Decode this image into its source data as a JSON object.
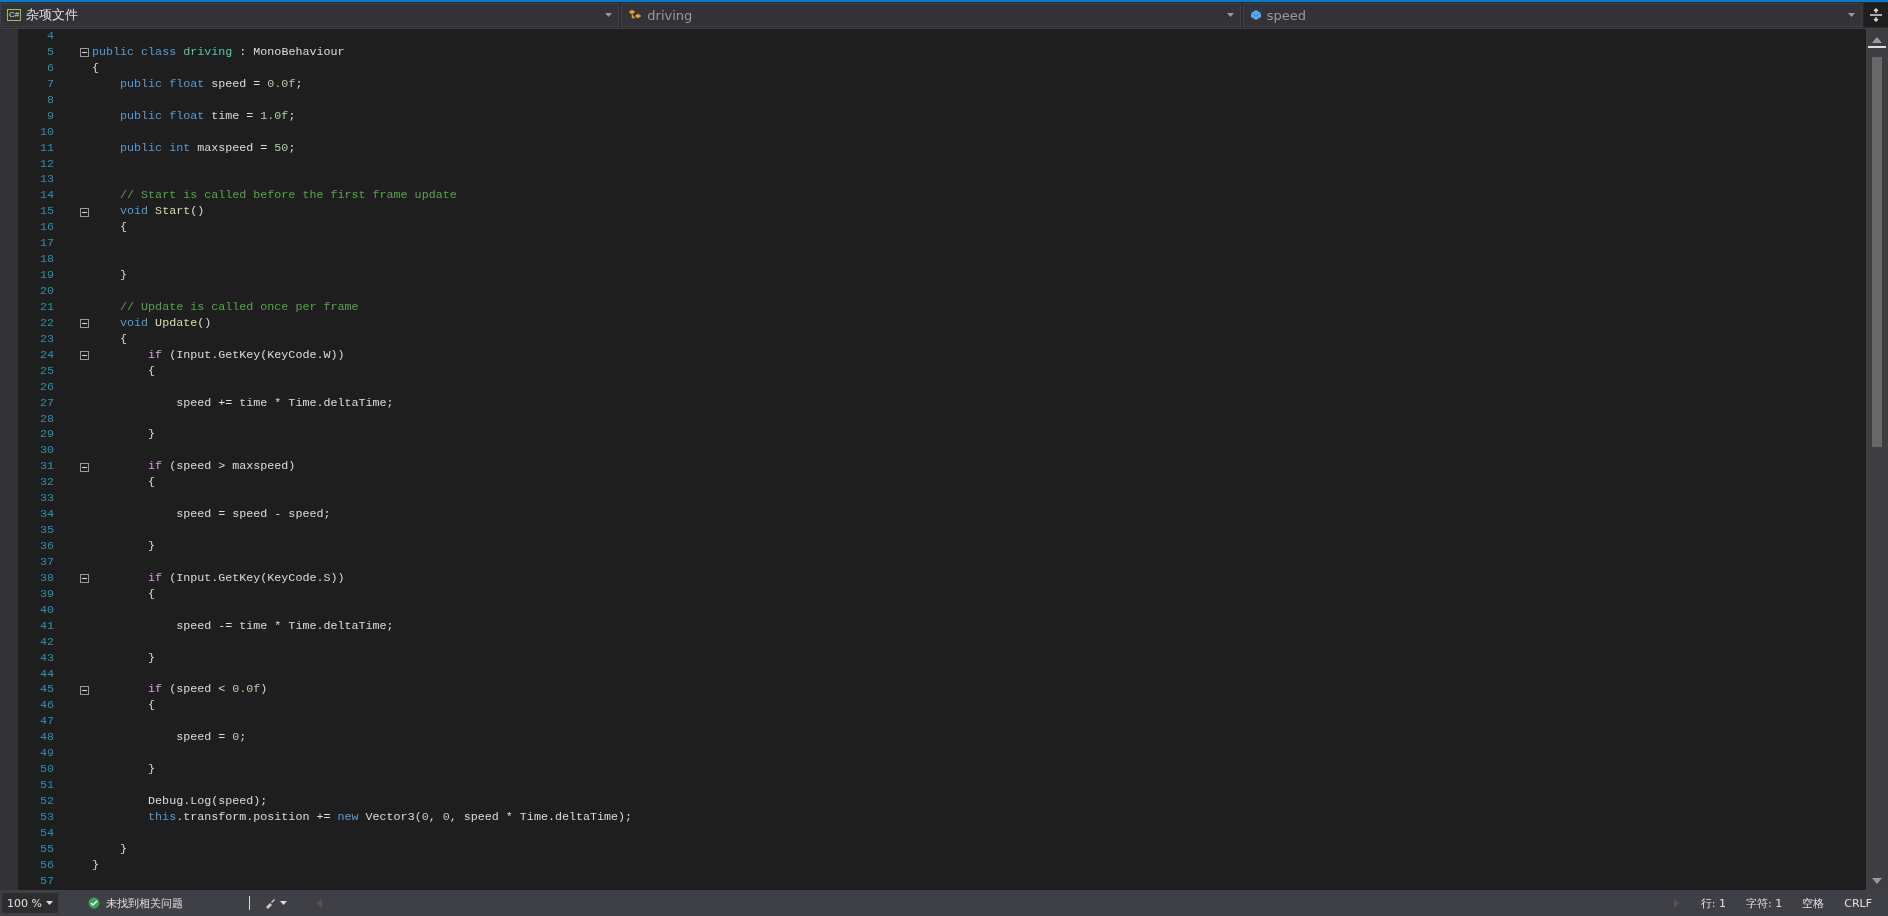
{
  "navigation_bar": {
    "language_badge": "C#",
    "project": "杂项文件",
    "type": "driving",
    "member": "speed"
  },
  "lines": [
    {
      "number": "4"
    },
    {
      "number": "5",
      "collapsed": false,
      "tokens": [
        {
          "kind": "kw",
          "text": "public class"
        },
        {
          "kind": "type",
          "text": " driving"
        },
        {
          "kind": "plain",
          "text": " : MonoBehaviour"
        }
      ]
    },
    {
      "number": "6",
      "tokens": [
        {
          "kind": "plain",
          "text": "{"
        }
      ]
    },
    {
      "number": "7",
      "tokens": [
        {
          "kind": "kw",
          "text": "    public float"
        },
        {
          "kind": "plain",
          "text": " speed = "
        },
        {
          "kind": "num",
          "text": "0.0f"
        },
        {
          "kind": "plain",
          "text": ";"
        }
      ]
    },
    {
      "number": "8"
    },
    {
      "number": "9",
      "tokens": [
        {
          "kind": "kw",
          "text": "    public float"
        },
        {
          "kind": "plain",
          "text": " time = "
        },
        {
          "kind": "num",
          "text": "1.0f"
        },
        {
          "kind": "plain",
          "text": ";"
        }
      ]
    },
    {
      "number": "10"
    },
    {
      "number": "11",
      "tokens": [
        {
          "kind": "kw",
          "text": "    public int"
        },
        {
          "kind": "plain",
          "text": " maxspeed = "
        },
        {
          "kind": "num",
          "text": "50"
        },
        {
          "kind": "plain",
          "text": ";"
        }
      ]
    },
    {
      "number": "12"
    },
    {
      "number": "13"
    },
    {
      "number": "14",
      "tokens": [
        {
          "kind": "cmt",
          "text": "    // Start is called before the first frame update"
        }
      ]
    },
    {
      "number": "15",
      "collapsed": false,
      "tokens": [
        {
          "kind": "kw",
          "text": "    void"
        },
        {
          "kind": "fn",
          "text": " Start"
        },
        {
          "kind": "plain",
          "text": "()"
        }
      ]
    },
    {
      "number": "16",
      "tokens": [
        {
          "kind": "plain",
          "text": "    {"
        }
      ]
    },
    {
      "number": "17"
    },
    {
      "number": "18"
    },
    {
      "number": "19",
      "tokens": [
        {
          "kind": "plain",
          "text": "    }"
        }
      ]
    },
    {
      "number": "20"
    },
    {
      "number": "21",
      "tokens": [
        {
          "kind": "cmt",
          "text": "    // Update is called once per frame"
        }
      ]
    },
    {
      "number": "22",
      "collapsed": false,
      "tokens": [
        {
          "kind": "kw",
          "text": "    void"
        },
        {
          "kind": "fn",
          "text": " Update"
        },
        {
          "kind": "plain",
          "text": "()"
        }
      ]
    },
    {
      "number": "23",
      "tokens": [
        {
          "kind": "plain",
          "text": "    {"
        }
      ]
    },
    {
      "number": "24",
      "collapsed": false,
      "tokens": [
        {
          "kind": "ctl",
          "text": "        if"
        },
        {
          "kind": "plain",
          "text": " (Input.GetKey(KeyCode.W))"
        }
      ]
    },
    {
      "number": "25",
      "tokens": [
        {
          "kind": "plain",
          "text": "        {"
        }
      ]
    },
    {
      "number": "26"
    },
    {
      "number": "27",
      "tokens": [
        {
          "kind": "plain",
          "text": "            speed += time * Time.deltaTime;"
        }
      ]
    },
    {
      "number": "28"
    },
    {
      "number": "29",
      "tokens": [
        {
          "kind": "plain",
          "text": "        }"
        }
      ]
    },
    {
      "number": "30"
    },
    {
      "number": "31",
      "collapsed": false,
      "tokens": [
        {
          "kind": "ctl",
          "text": "        if"
        },
        {
          "kind": "plain",
          "text": " (speed > maxspeed)"
        }
      ]
    },
    {
      "number": "32",
      "tokens": [
        {
          "kind": "plain",
          "text": "        {"
        }
      ]
    },
    {
      "number": "33"
    },
    {
      "number": "34",
      "tokens": [
        {
          "kind": "plain",
          "text": "            speed = speed - speed;"
        }
      ]
    },
    {
      "number": "35"
    },
    {
      "number": "36",
      "tokens": [
        {
          "kind": "plain",
          "text": "        }"
        }
      ]
    },
    {
      "number": "37"
    },
    {
      "number": "38",
      "collapsed": false,
      "tokens": [
        {
          "kind": "ctl",
          "text": "        if"
        },
        {
          "kind": "plain",
          "text": " (Input.GetKey(KeyCode.S))"
        }
      ]
    },
    {
      "number": "39",
      "tokens": [
        {
          "kind": "plain",
          "text": "        {"
        }
      ]
    },
    {
      "number": "40"
    },
    {
      "number": "41",
      "tokens": [
        {
          "kind": "plain",
          "text": "            speed -= time * Time.deltaTime;"
        }
      ]
    },
    {
      "number": "42"
    },
    {
      "number": "43",
      "tokens": [
        {
          "kind": "plain",
          "text": "        }"
        }
      ]
    },
    {
      "number": "44"
    },
    {
      "number": "45",
      "collapsed": false,
      "tokens": [
        {
          "kind": "ctl",
          "text": "        if"
        },
        {
          "kind": "plain",
          "text": " (speed < "
        },
        {
          "kind": "num",
          "text": "0.0f"
        },
        {
          "kind": "plain",
          "text": ")"
        }
      ]
    },
    {
      "number": "46",
      "tokens": [
        {
          "kind": "plain",
          "text": "        {"
        }
      ]
    },
    {
      "number": "47"
    },
    {
      "number": "48",
      "tokens": [
        {
          "kind": "plain",
          "text": "            speed = "
        },
        {
          "kind": "num",
          "text": "0"
        },
        {
          "kind": "plain",
          "text": ";"
        }
      ]
    },
    {
      "number": "49"
    },
    {
      "number": "50",
      "tokens": [
        {
          "kind": "plain",
          "text": "        }"
        }
      ]
    },
    {
      "number": "51"
    },
    {
      "number": "52",
      "tokens": [
        {
          "kind": "plain",
          "text": "        Debug.Log(speed);"
        }
      ]
    },
    {
      "number": "53",
      "tokens": [
        {
          "kind": "kw",
          "text": "        this"
        },
        {
          "kind": "plain",
          "text": ".transform.position += "
        },
        {
          "kind": "kw",
          "text": "new"
        },
        {
          "kind": "plain",
          "text": " Vector3("
        },
        {
          "kind": "num",
          "text": "0"
        },
        {
          "kind": "plain",
          "text": ", "
        },
        {
          "kind": "num",
          "text": "0"
        },
        {
          "kind": "plain",
          "text": ", speed * Time.deltaTime);"
        }
      ]
    },
    {
      "number": "54"
    },
    {
      "number": "55",
      "tokens": [
        {
          "kind": "plain",
          "text": "    }"
        }
      ]
    },
    {
      "number": "56",
      "tokens": [
        {
          "kind": "plain",
          "text": "}"
        }
      ]
    },
    {
      "number": "57"
    }
  ],
  "status_bar": {
    "zoom": "100 %",
    "issues": "未找到相关问题",
    "line": "行: 1",
    "char": "字符: 1",
    "spaces": "空格",
    "line_ending": "CRLF"
  }
}
